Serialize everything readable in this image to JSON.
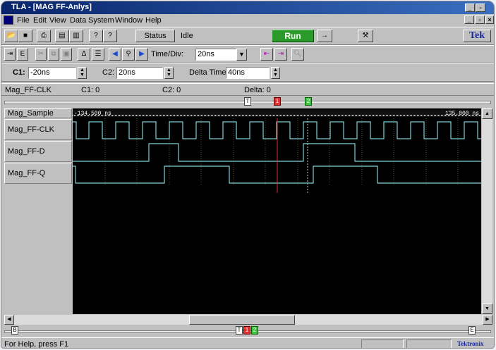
{
  "window": {
    "title": "TLA - [MAG FF-Anlys]"
  },
  "menu": {
    "items": [
      "File",
      "Edit",
      "View",
      "Data",
      "System",
      "Window",
      "Help"
    ]
  },
  "toolbar1": {
    "status_label": "Status",
    "status_value": "Idle",
    "run_label": "Run",
    "arrow_label": "→",
    "brand": "Tek"
  },
  "toolbar2": {
    "timediv_label": "Time/Div:",
    "timediv_value": "20ns"
  },
  "toolbar3": {
    "c1_label": "C1:",
    "c1_value": "-20ns",
    "c2_label": "C2:",
    "c2_value": "20ns",
    "delta_label": "Delta Time:",
    "delta_value": "40ns"
  },
  "infobar": {
    "signal": "Mag_FF-CLK",
    "c1": "C1: 0",
    "c2": "C2: 0",
    "delta": "Delta: 0"
  },
  "signals": {
    "sample": "Mag_Sample",
    "clk": "Mag_FF-CLK",
    "d": "Mag_FF-D",
    "q": "Mag_FF-Q"
  },
  "waveform": {
    "start_time": "-134.500 ns",
    "end_time": "135.000 ns"
  },
  "statusbar": {
    "help": "For Help, press F1",
    "brand": "Tektronix"
  },
  "colors": {
    "trace": "#7fd3d6",
    "cursor1": "#e03030",
    "cursor2": "#40c040",
    "grid": "#606040"
  }
}
